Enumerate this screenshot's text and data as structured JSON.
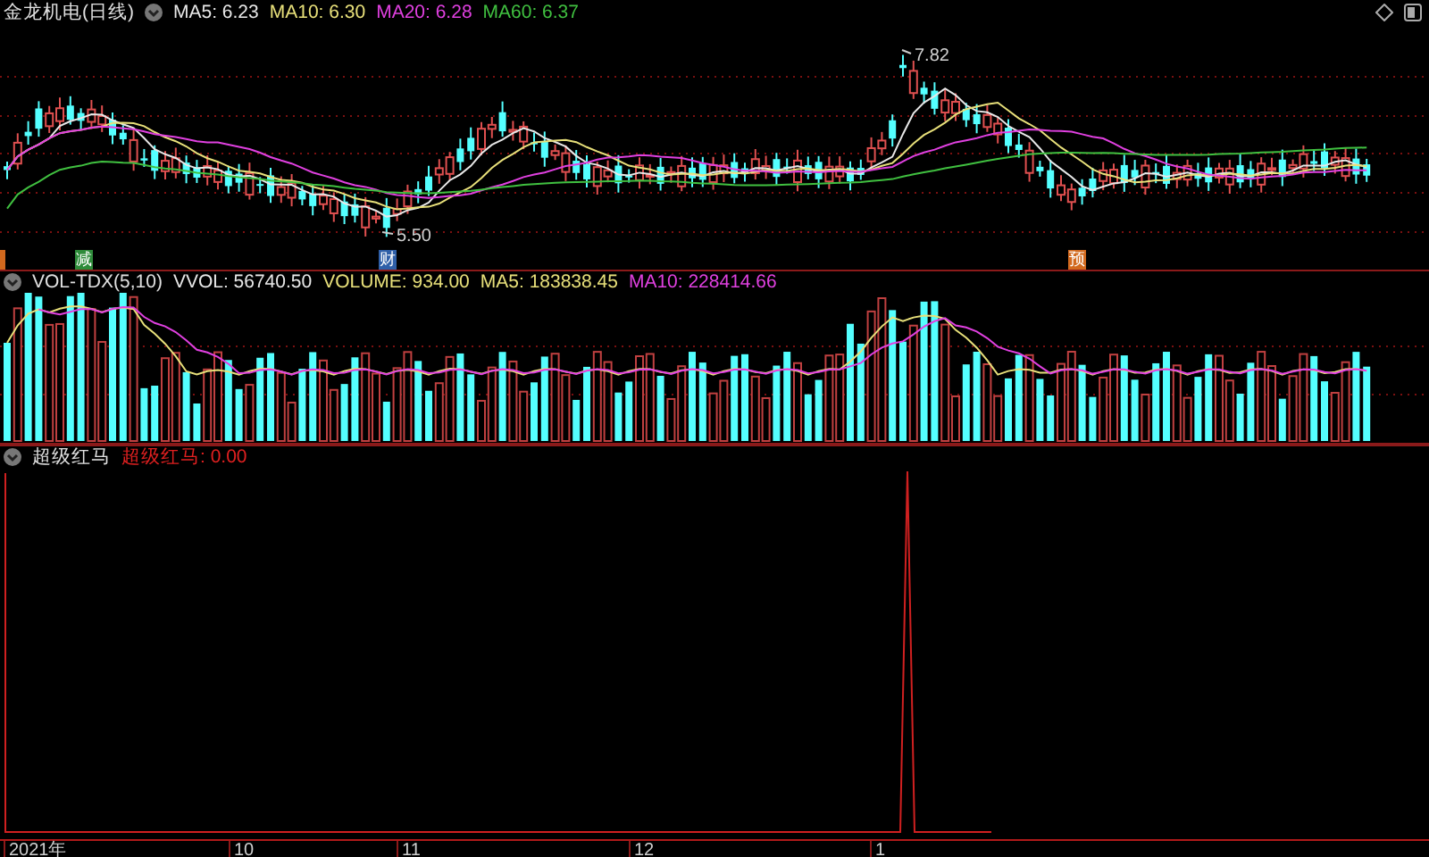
{
  "header": {
    "title": "金龙机电(日线)",
    "indicators": [
      {
        "label": "MA5: 6.23",
        "color": "#e8e8e8"
      },
      {
        "label": "MA10: 6.30",
        "color": "#e8e07a"
      },
      {
        "label": "MA20: 6.28",
        "color": "#e040e0"
      },
      {
        "label": "MA60: 6.37",
        "color": "#40c040"
      }
    ]
  },
  "price_chart": {
    "high_label": "7.82",
    "low_label": "5.50",
    "events": [
      {
        "label": "减",
        "color": "#2e8b3a"
      },
      {
        "label": "财",
        "color": "#2f5fa8"
      },
      {
        "label": "预",
        "color": "#d2691e"
      }
    ]
  },
  "volume_header": {
    "title": "VOL-TDX(5,10)",
    "values": [
      {
        "label": "VVOL: 56740.50",
        "color": "#e8e8e8"
      },
      {
        "label": "VOLUME: 934.00",
        "color": "#e8e07a"
      },
      {
        "label": "MA5: 183838.45",
        "color": "#e8e07a"
      },
      {
        "label": "MA10: 228414.66",
        "color": "#e040e0"
      }
    ]
  },
  "indicator_header": {
    "title": "超级红马",
    "value": "超级红马: 0.00"
  },
  "x_axis": [
    "2021年",
    "10",
    "11",
    "12",
    "1"
  ]
}
